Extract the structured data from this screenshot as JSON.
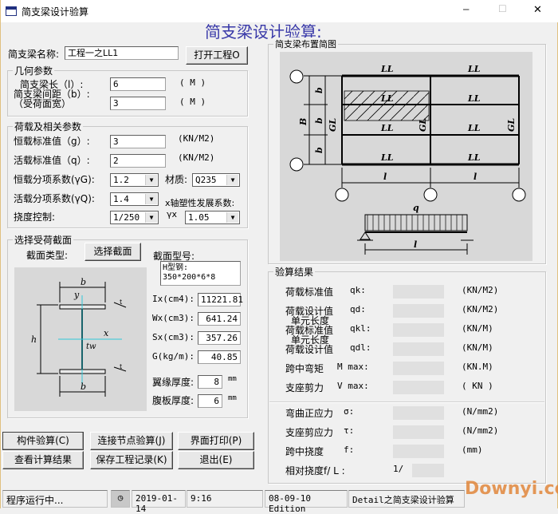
{
  "window": {
    "title": "简支梁设计验算",
    "minimize": "─",
    "maximize": "☐",
    "close": "✕"
  },
  "header": {
    "title": "简支梁设计验算:"
  },
  "name": {
    "label": "简支梁名称:",
    "value": "工程一之LL1",
    "open_button": "打开工程O"
  },
  "geometry": {
    "legend": "几何参数",
    "length_label": "简支梁长（l）:",
    "length_value": "6",
    "length_unit": "( M )",
    "spacing_label1": "简支梁间距（b）:",
    "spacing_label2": "（受荷面宽）",
    "spacing_value": "3",
    "spacing_unit": "( M )"
  },
  "loads": {
    "legend": "荷载及相关参数",
    "dead_label": "恒载标准值（g）:",
    "dead_value": "3",
    "dead_unit": "(KN/M2)",
    "live_label": "活载标准值（q）:",
    "live_value": "2",
    "live_unit": "(KN/M2)",
    "gamma_g_label": "恒载分项系数(γG):",
    "gamma_g_value": "1.2",
    "material_label": "材质:",
    "material_value": "Q235",
    "gamma_q_label": "活载分项系数(γQ):",
    "gamma_q_value": "1.4",
    "plastic_label": "x轴塑性发展系数:",
    "gamma_x_label": "γx",
    "gamma_x_value": "1.05",
    "deflection_label": "挠度控制:",
    "deflection_value": "1/250"
  },
  "section": {
    "legend": "选择受荷截面",
    "type_label": "截面类型:",
    "select_button": "选择截面",
    "model_label": "截面型号:",
    "model_value": "H型钢:\n350*200*6*8",
    "ix_label": "Ix(cm4):",
    "ix_value": "11221.81",
    "wx_label": "Wx(cm3):",
    "wx_value": "641.24",
    "sx_label": "Sx(cm3):",
    "sx_value": "357.26",
    "g_label": "G(kg/m):",
    "g_value": "40.85",
    "flange_label": "翼缘厚度:",
    "flange_value": "8",
    "web_label": "腹板厚度:",
    "web_value": "6",
    "mm": "mm",
    "diagram": {
      "b": "b",
      "y": "y",
      "x": "x",
      "h": "h",
      "tw": "tw",
      "t": "t"
    }
  },
  "buttons": {
    "check": "构件验算(C)",
    "joint": "连接节点验算(J)",
    "print": "界面打印(P)",
    "view": "查看计算结果",
    "save": "保存工程记录(K)",
    "exit": "退出(E)"
  },
  "layout": {
    "legend": "简支梁布置简图",
    "LL": "LL",
    "GL": "GL",
    "B": "B",
    "b": "b",
    "l": "l",
    "q": "q"
  },
  "results": {
    "legend": "验算结果",
    "rows": [
      {
        "label": "荷载标准值",
        "sym": "qk:",
        "unit": "(KN/M2)"
      },
      {
        "label": "荷载设计值",
        "sym": "qd:",
        "unit": "(KN/M2)"
      },
      {
        "label": "荷载标准值",
        "pre": "单元长度",
        "sym": "qkl:",
        "unit": "(KN/M)"
      },
      {
        "label": "荷载设计值",
        "pre": "单元长度",
        "sym": "qdl:",
        "unit": "(KN/M)"
      },
      {
        "label": "跨中弯矩",
        "sym": "M max:",
        "unit": "(KN.M)"
      },
      {
        "label": "支座剪力",
        "sym": "V max:",
        "unit": "( KN )"
      },
      {
        "label": "弯曲正应力",
        "sym": "σ:",
        "unit": "(N/mm2)"
      },
      {
        "label": "支座剪应力",
        "sym": "τ:",
        "unit": "(N/mm2)"
      },
      {
        "label": "跨中挠度",
        "sym": "f:",
        "unit": "(mm)"
      },
      {
        "label": "相对挠度f/ L :",
        "sym": "1/",
        "unit": ""
      }
    ]
  },
  "status": {
    "running": "程序运行中...",
    "date": "2019-01-14",
    "time": "9:16",
    "edition": "08-09-10 Edition",
    "app": "Detail之简支梁设计验算"
  },
  "watermark": "Downyi.com"
}
